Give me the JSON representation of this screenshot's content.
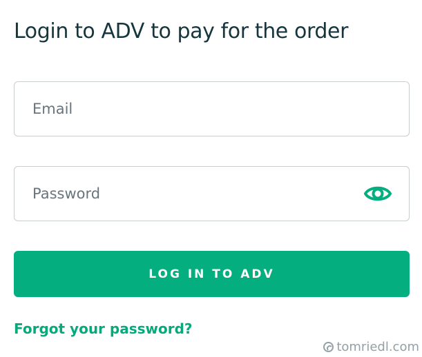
{
  "login": {
    "title": "Login to ADV to pay for the order",
    "email": {
      "placeholder": "Email",
      "value": ""
    },
    "password": {
      "placeholder": "Password",
      "value": ""
    },
    "password_visibility_icon": "eye-icon",
    "submit_label": "LOG IN TO ADV",
    "forgot_password_label": "Forgot your password?"
  },
  "watermark": {
    "text": "tomriedl.com",
    "icon": "watermark-mark-icon"
  },
  "colors": {
    "accent": "#05AE7F",
    "title_text": "#15363D",
    "placeholder_text": "#68757D",
    "field_border": "#C8CDD0",
    "button_text": "#FFFFFF",
    "watermark_text": "#94A0A5"
  }
}
